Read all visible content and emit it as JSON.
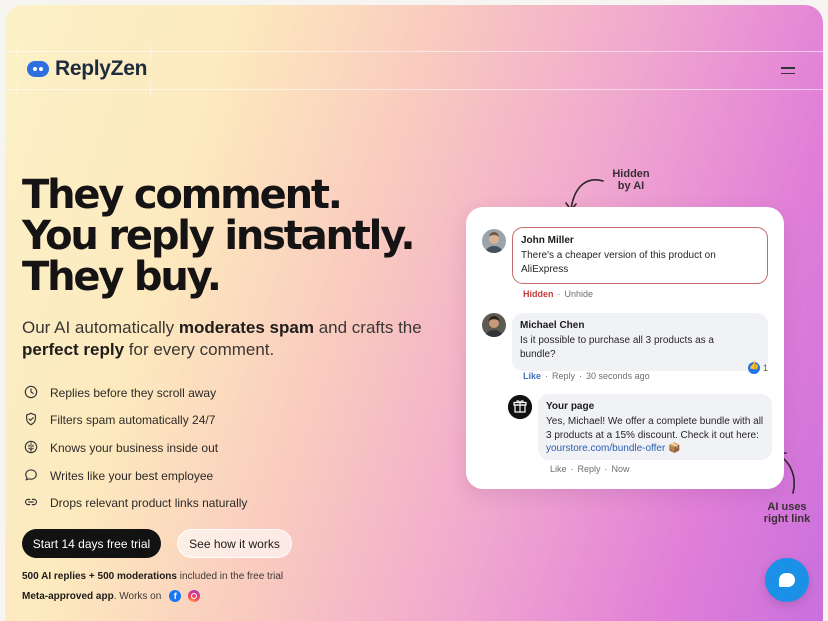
{
  "brand": {
    "name": "ReplyZen",
    "color": "#2f6fe0"
  },
  "header": {
    "menu_icon": "hamburger-icon"
  },
  "hero": {
    "title_lines": [
      "They comment.",
      "You reply instantly.",
      "They buy."
    ],
    "subtitle": {
      "part1": "Our AI automatically ",
      "bold1": "moderates spam",
      "part2": " and crafts the ",
      "bold2": "perfect reply",
      "part3": " for every comment."
    }
  },
  "features": [
    {
      "icon": "clock-icon",
      "label": "Replies before they scroll away"
    },
    {
      "icon": "shield-check-icon",
      "label": "Filters spam automatically 24/7"
    },
    {
      "icon": "brain-icon",
      "label": "Knows your business inside out"
    },
    {
      "icon": "message-icon",
      "label": "Writes like your best employee"
    },
    {
      "icon": "link-icon",
      "label": "Drops relevant product links naturally"
    }
  ],
  "cta": {
    "primary": "Start 14 days free trial",
    "secondary": "See how it works"
  },
  "notes": {
    "trial_bold": "500 AI replies + 500 moderations",
    "trial_rest": " included in the free trial",
    "meta_bold": "Meta-approved app",
    "meta_rest": ". Works on",
    "fb_glyph": "f"
  },
  "annotations": {
    "hidden_line1": "Hidden",
    "hidden_line2": "by AI",
    "link_line1": "AI uses",
    "link_line2": "right link"
  },
  "comments": [
    {
      "name": "John Miller",
      "text": "There's a cheaper version of this product on AliExpress",
      "status": "Hidden",
      "action": "Unhide",
      "separator": "·"
    },
    {
      "name": "Michael Chen",
      "text": "Is it possible to purchase all 3 products as a bundle?",
      "like": "Like",
      "reply": "Reply",
      "time": "30 seconds ago",
      "separator": "·",
      "reaction_count": "1"
    }
  ],
  "reply": {
    "name": "Your page",
    "text": "Yes, Michael! We offer a complete bundle with all 3 products at a 15% discount. Check it out here: ",
    "link": "yourstore.com/bundle-offer",
    "emoji": "📦",
    "like": "Like",
    "reply_label": "Reply",
    "time": "Now",
    "separator": "·"
  },
  "colors": {
    "gradient_start": "#fbf1c7",
    "gradient_end": "#c970de",
    "hidden_red": "#c23b3b",
    "chat_button": "#1a91e6"
  }
}
